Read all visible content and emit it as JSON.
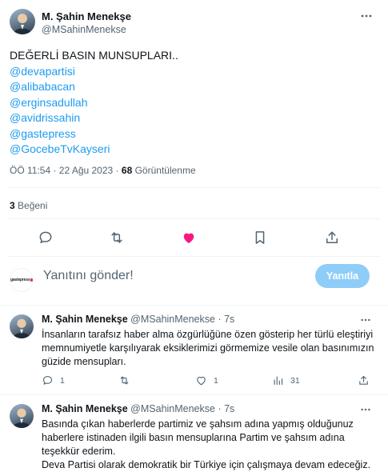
{
  "main_tweet": {
    "author_name": "M. Şahin Menekşe",
    "author_handle": "@MSahinMenekse",
    "text_lines": [
      "DEĞERLİ BASIN MUNSUPLARI..",
      "@devapartisi",
      "@alibabacan",
      "@erginsadullah",
      "@avidrissahin",
      "@gastepress",
      "@GocebeTvKayseri"
    ],
    "time": "ÖÖ 11:54 · 22 Ağu 2023 ·",
    "views_count": "68",
    "views_label": "Görüntülenme",
    "likes_count": "3",
    "likes_label": "Beğeni",
    "liked": true,
    "colors": {
      "like": "#f91880",
      "mention": "#1d9bf0",
      "muted": "#536471"
    }
  },
  "actions": {
    "icons": [
      "reply-icon",
      "retweet-icon",
      "like-icon",
      "bookmark-icon",
      "share-icon"
    ]
  },
  "reply_composer": {
    "placeholder": "Yanıtını gönder!",
    "button_label": "Yanıtla",
    "avatar_logo": "gastepress"
  },
  "replies": [
    {
      "author_name": "M. Şahin Menekşe",
      "author_handle": "@MSahinMenekse",
      "time": "· 7s",
      "text_lines": [
        "İnsanların tarafsız haber alma özgürlüğüne özen gösterip her türlü eleştiriyi",
        "memnumiyetle karşılıyarak eksiklerimizi görmemize vesile olan basınımızın",
        "güzide mensupları."
      ],
      "reply_count": "1",
      "retweet_count": "",
      "like_count": "1",
      "view_count": "31"
    },
    {
      "author_name": "M. Şahin Menekşe",
      "author_handle": "@MSahinMenekse",
      "time": "· 7s",
      "text_lines": [
        "Basında çıkan haberlerde partimiz ve şahsım adına yapmış olduğunuz",
        "haberlere istinaden ilgili basın mensuplarına Partim ve şahsım adına",
        "teşekkür ederim.",
        "Deva Partisi olarak demokratik bir Türkiye için çalışmaya devam edeceğiz."
      ]
    }
  ]
}
